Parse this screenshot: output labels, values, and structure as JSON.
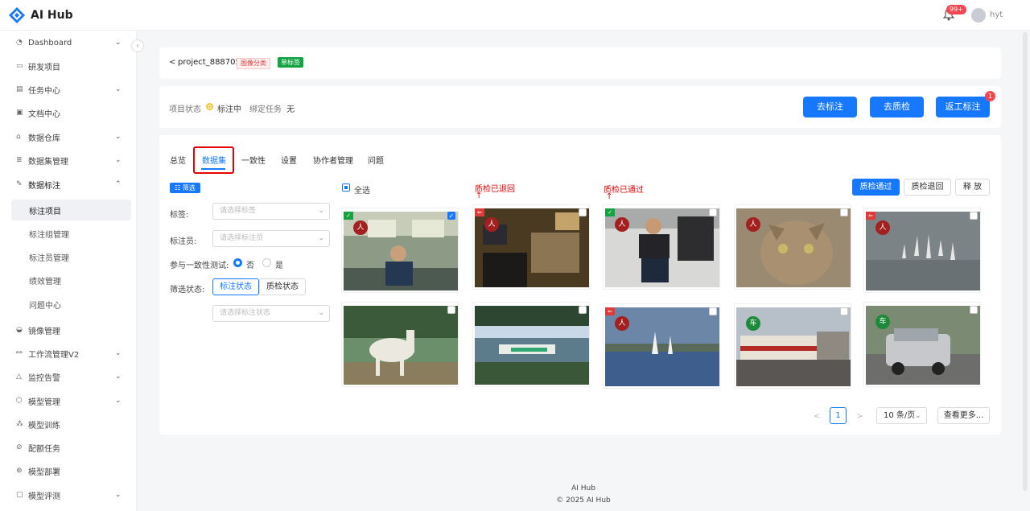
{
  "app": {
    "name": "AI Hub",
    "notif_badge": "99+",
    "user": "hyt"
  },
  "sidebar": {
    "items": [
      {
        "label": "Dashboard",
        "icon": "dashboard-icon",
        "chev": "⌄"
      },
      {
        "label": "研发项目",
        "icon": "folder-icon",
        "chev": ""
      },
      {
        "label": "任务中心",
        "icon": "task-icon",
        "chev": "⌄"
      },
      {
        "label": "文档中心",
        "icon": "doc-icon",
        "chev": ""
      },
      {
        "label": "数据仓库",
        "icon": "home-icon",
        "chev": "⌄"
      },
      {
        "label": "数据集管理",
        "icon": "database-icon",
        "chev": "⌄"
      },
      {
        "label": "数据标注",
        "icon": "pen-icon",
        "chev": "⌃"
      }
    ],
    "sub_items": [
      "标注项目",
      "标注组管理",
      "标注员管理",
      "绩效管理",
      "问题中心"
    ],
    "items2": [
      {
        "label": "镜像管理",
        "icon": "image-icon",
        "chev": ""
      },
      {
        "label": "工作流管理V2",
        "icon": "workflow-icon",
        "chev": "⌄"
      },
      {
        "label": "监控告警",
        "icon": "alert-icon",
        "chev": "⌄"
      },
      {
        "label": "模型管理",
        "icon": "model-icon",
        "chev": "⌄"
      },
      {
        "label": "模型训练",
        "icon": "train-icon",
        "chev": ""
      },
      {
        "label": "配额任务",
        "icon": "quota-icon",
        "chev": ""
      },
      {
        "label": "模型部署",
        "icon": "deploy-icon",
        "chev": ""
      },
      {
        "label": "模型评测",
        "icon": "eval-icon",
        "chev": "⌄"
      }
    ]
  },
  "project": {
    "back": "<",
    "name": "project_888705",
    "tag_type": "图像分类",
    "tag_label": "单标签"
  },
  "status": {
    "label": "项目状态",
    "value": "标注中",
    "bind_label": "绑定任务",
    "bind_value": "无"
  },
  "actions": {
    "annotate": "去标注",
    "qc": "去质检",
    "rework": "返工标注",
    "rework_badge": "1"
  },
  "tabs": [
    "总览",
    "数据集",
    "一致性",
    "设置",
    "协作者管理",
    "问题"
  ],
  "filter": {
    "button": "筛选",
    "tag_label": "标签:",
    "tag_placeholder": "请选择标签",
    "annotator_label": "标注员:",
    "annotator_placeholder": "请选择标注员",
    "consistency_label": "参与一致性测试:",
    "no": "否",
    "yes": "是",
    "state_label": "筛选状态:",
    "state_tab1": "标注状态",
    "state_tab2": "质检状态",
    "state_placeholder": "请选择标注状态"
  },
  "grid": {
    "select_all": "全选",
    "btn_pass": "质检通过",
    "btn_reject": "质检退回",
    "btn_release": "释 放",
    "annot_rejected": "质检已退回",
    "annot_passed": "质检已通过",
    "thumbs": [
      {
        "label": "人",
        "qc": "passed",
        "checked": true
      },
      {
        "label": "人",
        "qc": "rejected",
        "checked": false
      },
      {
        "label": "人",
        "qc": "passed",
        "checked": false
      },
      {
        "label": "人",
        "qc": "none",
        "checked": false
      },
      {
        "label": "人",
        "qc": "rejected",
        "checked": false
      },
      {
        "label": "",
        "qc": "none",
        "checked": false
      },
      {
        "label": "",
        "qc": "none",
        "checked": false
      },
      {
        "label": "人",
        "qc": "rejected",
        "checked": false
      },
      {
        "label": "车",
        "qc": "none",
        "checked": false
      },
      {
        "label": "车",
        "qc": "none",
        "checked": false
      }
    ]
  },
  "pagination": {
    "prev": "<",
    "page": "1",
    "next": ">",
    "page_size": "10 条/页",
    "more": "查看更多..."
  },
  "footer": {
    "line1": "AI Hub",
    "line2": "2025 AI Hub"
  },
  "colors": {
    "primary": "#1677ff",
    "label_person": "#a32020",
    "label_car": "#1d8a3a",
    "danger": "#e60000"
  }
}
